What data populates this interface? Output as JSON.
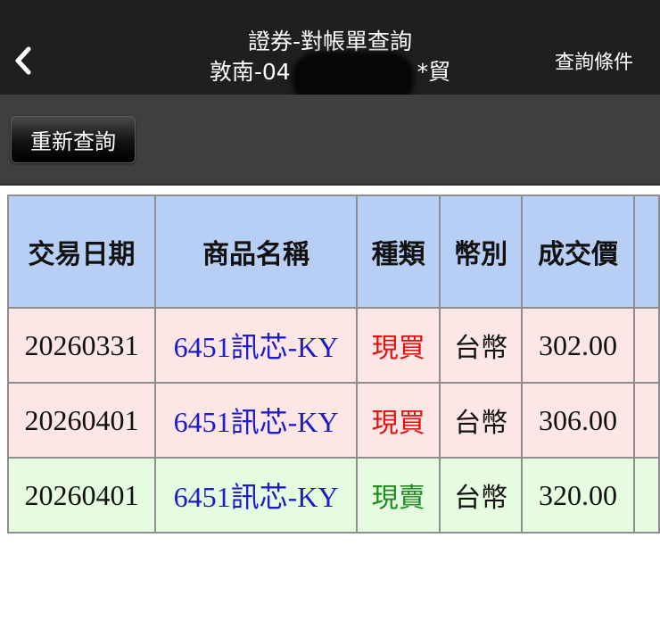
{
  "header": {
    "title": "證券-對帳單查詢",
    "account_prefix": "敦南-04",
    "account_suffix": "*貿",
    "query_conditions_label": "查詢條件"
  },
  "toolbar": {
    "requery_label": "重新查詢"
  },
  "table": {
    "columns": [
      "交易日期",
      "商品名稱",
      "種類",
      "幣別",
      "成交價"
    ],
    "rows": [
      {
        "date": "20260331",
        "product": "6451訊芯-KY",
        "type": "現買",
        "currency": "台幣",
        "price": "302.00"
      },
      {
        "date": "20260401",
        "product": "6451訊芯-KY",
        "type": "現買",
        "currency": "台幣",
        "price": "306.00"
      },
      {
        "date": "20260401",
        "product": "6451訊芯-KY",
        "type": "現賣",
        "currency": "台幣",
        "price": "320.00"
      }
    ]
  },
  "colors": {
    "header_bg": "#1f1f1f",
    "toolbar_bg": "#3f3f3f",
    "table_header_bg": "#b7cff4",
    "buy_row_bg": "#fce6e6",
    "sell_row_bg": "#e6fce0",
    "buy_text": "#e41010",
    "sell_text": "#1f8a1f",
    "product_text": "#1c1ccc"
  },
  "icons": {
    "back": "chevron-left-icon"
  }
}
